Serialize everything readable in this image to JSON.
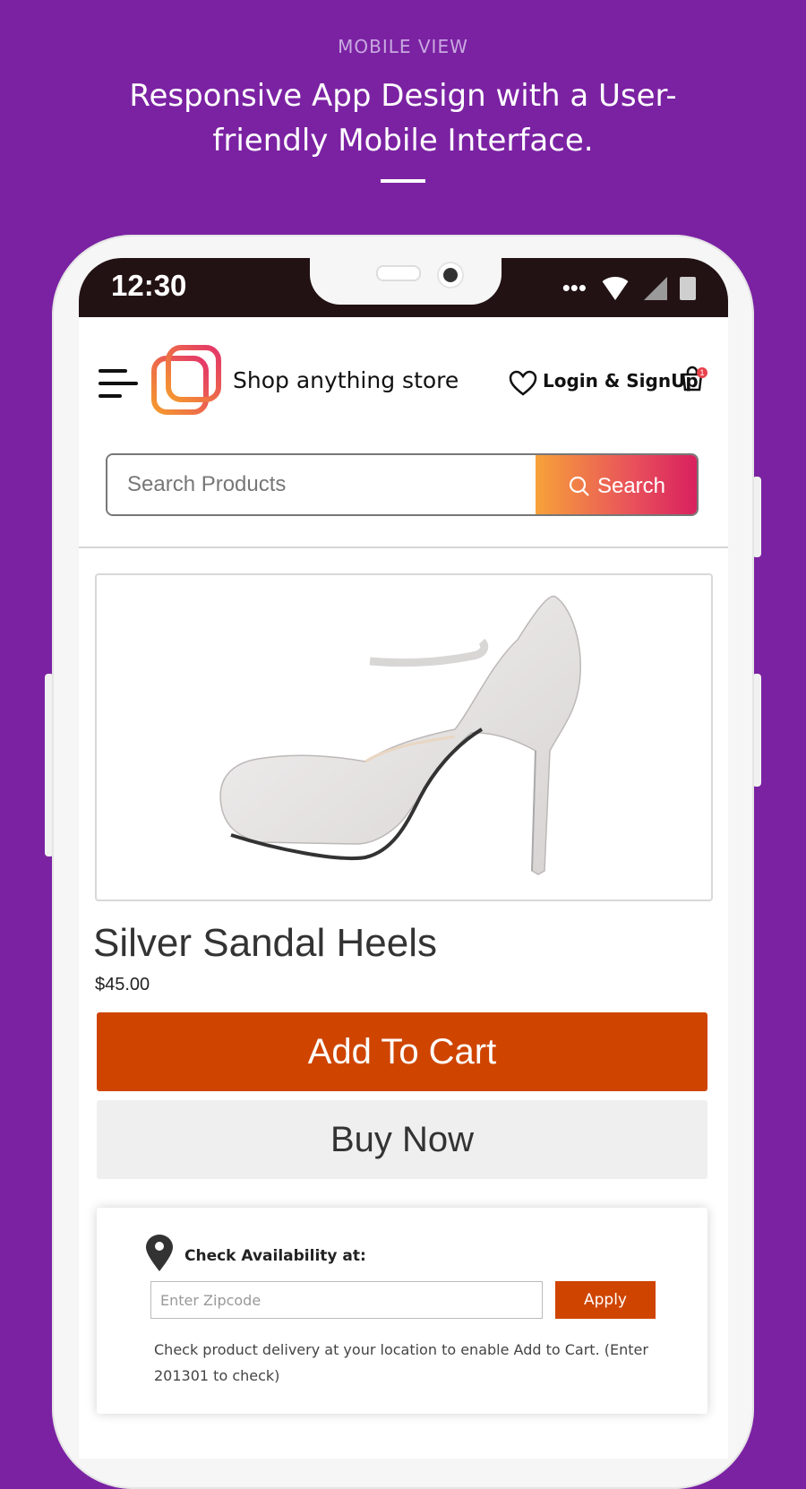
{
  "hero": {
    "kicker": "MOBILE VIEW",
    "title": "Responsive App Design with a User-friendly Mobile Interface."
  },
  "status_bar": {
    "time": "12:30",
    "notification_dots": "•••",
    "icons": [
      "wifi-icon",
      "signal-icon",
      "battery-icon"
    ]
  },
  "header": {
    "store_name": "Shop anything store",
    "login_label": "Login & SignUp",
    "cart_count": "1"
  },
  "search": {
    "placeholder": "Search Products",
    "button_label": "Search"
  },
  "product": {
    "title": "Silver Sandal Heels",
    "price": "$45.00",
    "add_to_cart_label": "Add To Cart",
    "buy_now_label": "Buy Now"
  },
  "availability": {
    "label": "Check Availability at:",
    "zip_placeholder": "Enter Zipcode",
    "apply_label": "Apply",
    "note": "Check product delivery at your location to enable Add to Cart. (Enter 201301 to check)"
  },
  "colors": {
    "background": "#7b22a3",
    "primary_orange": "#cf4500",
    "search_gradient_start": "#f7a23a",
    "search_gradient_end": "#d81f5f",
    "status_bar": "#231214"
  }
}
